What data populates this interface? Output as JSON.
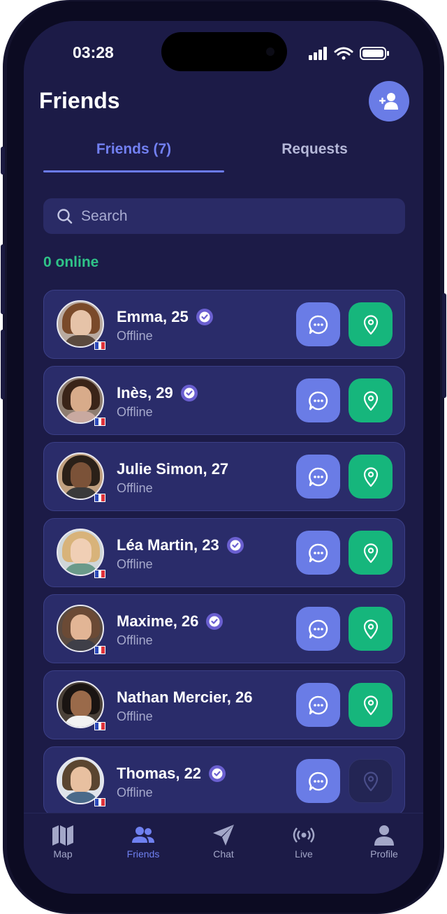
{
  "status_bar": {
    "time": "03:28"
  },
  "header": {
    "title": "Friends",
    "add_friend_icon": "user-plus-icon"
  },
  "tabs": [
    {
      "label": "Friends (7)",
      "active": true
    },
    {
      "label": "Requests",
      "active": false
    }
  ],
  "search": {
    "placeholder": "Search",
    "value": ""
  },
  "online_label": "0 online",
  "friends": [
    {
      "name": "Emma, 25",
      "status": "Offline",
      "verified": true,
      "flag": "france",
      "location_enabled": true
    },
    {
      "name": "Inès, 29",
      "status": "Offline",
      "verified": true,
      "flag": "france",
      "location_enabled": true
    },
    {
      "name": "Julie Simon, 27",
      "status": "Offline",
      "verified": false,
      "flag": "france",
      "location_enabled": true
    },
    {
      "name": "Léa Martin, 23",
      "status": "Offline",
      "verified": true,
      "flag": "france",
      "location_enabled": true
    },
    {
      "name": "Maxime, 26",
      "status": "Offline",
      "verified": true,
      "flag": "france",
      "location_enabled": true
    },
    {
      "name": "Nathan Mercier, 26",
      "status": "Offline",
      "verified": false,
      "flag": "france",
      "location_enabled": true
    },
    {
      "name": "Thomas, 22",
      "status": "Offline",
      "verified": true,
      "flag": "france",
      "location_enabled": false
    }
  ],
  "bottom_nav": [
    {
      "label": "Map",
      "icon": "map-icon",
      "active": false
    },
    {
      "label": "Friends",
      "icon": "friends-icon",
      "active": true
    },
    {
      "label": "Chat",
      "icon": "send-icon",
      "active": false
    },
    {
      "label": "Live",
      "icon": "broadcast-icon",
      "active": false
    },
    {
      "label": "Profile",
      "icon": "profile-icon",
      "active": false
    }
  ],
  "colors": {
    "background": "#1c1b47",
    "card": "#2a2c6a",
    "accent": "#6a7ce6",
    "online_green": "#2fc388",
    "location_green": "#16b67c"
  }
}
